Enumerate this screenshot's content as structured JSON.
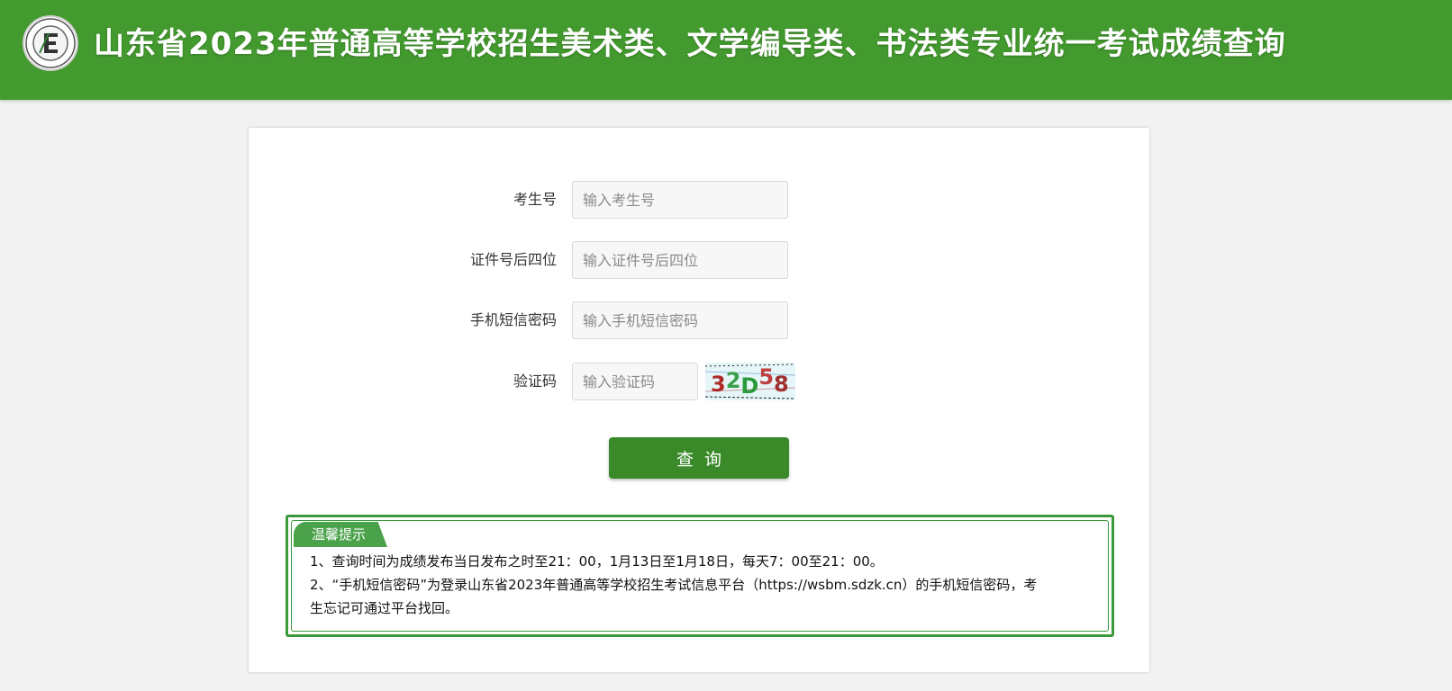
{
  "header": {
    "title": "山东省2023年普通高等学校招生美术类、文学编导类、书法类专业统一考试成绩查询",
    "background_color": "#439a2e",
    "logo_icon": "exam-authority-seal-icon"
  },
  "form": {
    "fields": [
      {
        "label": "考生号",
        "placeholder": "输入考生号",
        "value": ""
      },
      {
        "label": "证件号后四位",
        "placeholder": "输入证件号后四位",
        "value": ""
      },
      {
        "label": "手机短信密码",
        "placeholder": "输入手机短信密码",
        "value": ""
      },
      {
        "label": "验证码",
        "placeholder": "输入验证码",
        "value": ""
      }
    ],
    "captcha_text": "32D58",
    "submit_label": "查询",
    "button_color": "#3a8a2a"
  },
  "notice": {
    "title": "温馨提示",
    "lines": [
      "1、查询时间为成绩发布当日发布之时至21：00，1月13日至1月18日，每天7：00至21：00。",
      "2、“手机短信密码”为登录山东省2023年普通高等学校招生考试信息平台（https://wsbm.sdzk.cn）的手机短信密码，考",
      "生忘记可通过平台找回。"
    ],
    "border_color": "#3a9a3a"
  }
}
